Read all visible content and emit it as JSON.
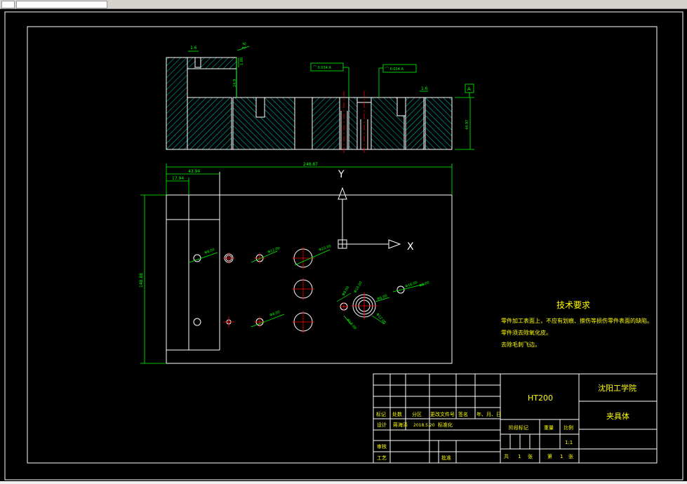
{
  "colors": {
    "background": "#000000",
    "frame": "#ffffff",
    "section": "#ffffff",
    "hatch": "#00ffff",
    "dimension": "#00ff00",
    "centerline": "#ff0000",
    "text_green": "#00ff00",
    "text_yellow": "#ffff00",
    "axis": "#ffffff"
  },
  "axes": {
    "y_label": "Y",
    "x_label": "X"
  },
  "section_view": {
    "roughness_1": "1.6",
    "roughness_2": "1.6",
    "roughness_3": "1.6",
    "dim_small": "1.00",
    "dim_mid": "24.9",
    "dim_height": "44.97",
    "tolerance_1": "⌒ 0.034 A",
    "tolerance_2": "⌒ 0.034 A",
    "datum": "A"
  },
  "plan_view": {
    "dim_total_width": "248.87",
    "dim_left_width": "43.94",
    "dim_small": "17.94",
    "dim_height": "148.88",
    "hole_labels": [
      "Φ8.00",
      "Φ12.00",
      "Φ23.00",
      "Φ8.00",
      "Φ8.00",
      "Φ16.00",
      "Φ6.00",
      "Φ12.00",
      "Φ18.00",
      "Φ8.00",
      "Φ10.00"
    ]
  },
  "tech_requirements": {
    "title": "技术要求",
    "lines": [
      "零件加工表面上，不应有划痕、擦伤等损伤零件表面的缺陷。",
      "零件须去除氧化皮。",
      "去除毛刺飞边。"
    ]
  },
  "title_block": {
    "material": "HT200",
    "school": "沈阳工学院",
    "part_name": "夹具体",
    "header_cols": [
      "标记",
      "处数",
      "分区",
      "更改文件号",
      "签名",
      "年、月、日"
    ],
    "design_label": "设计",
    "designer": "蒋海泽",
    "design_date": "2018.5.20",
    "standardization": "标准化",
    "review_label": "审核",
    "process_label": "工艺",
    "approve_label": "批准",
    "stage_mark": "阶段标记",
    "weight": "重量",
    "scale_label": "比例",
    "scale": "1:1",
    "total_label": "共",
    "total_sheets": "1",
    "sheet_unit": "张",
    "sheet_label": "第",
    "sheet_no": "1",
    "sheet_unit2": "张"
  }
}
